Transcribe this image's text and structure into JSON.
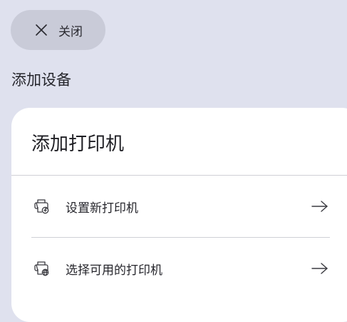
{
  "header": {
    "close_label": "关闭",
    "close_icon": "close-icon"
  },
  "section": {
    "title": "添加设备"
  },
  "card": {
    "title": "添加打印机",
    "options": [
      {
        "label": "设置新打印机",
        "icon": "printer-add-icon",
        "arrow": "arrow-right-icon"
      },
      {
        "label": "选择可用的打印机",
        "icon": "printer-network-icon",
        "arrow": "arrow-right-icon"
      }
    ]
  },
  "colors": {
    "background": "#dfe1ee",
    "close_button": "#c9cbd8",
    "card": "#ffffff",
    "divider": "#cfd0d6",
    "text": "#1f1f24"
  }
}
